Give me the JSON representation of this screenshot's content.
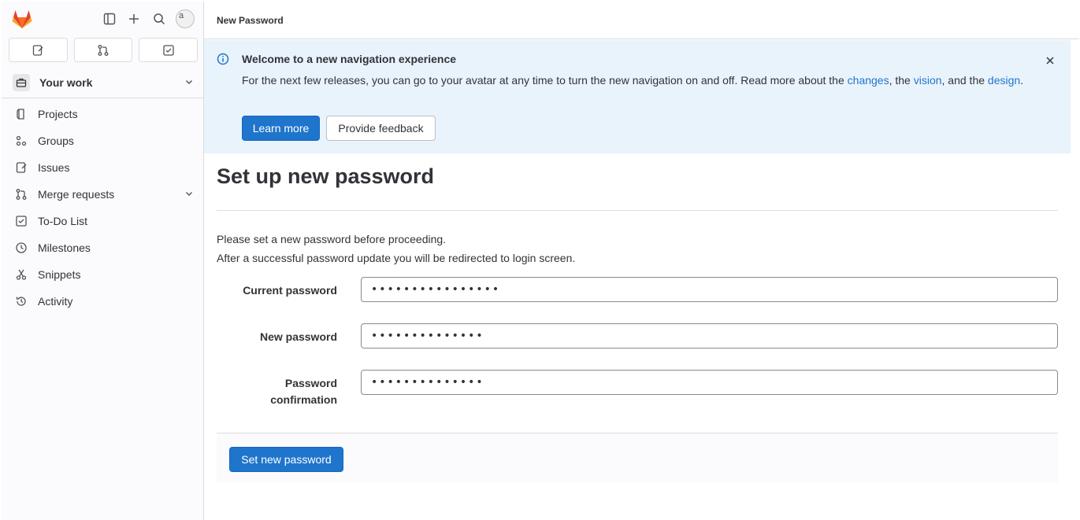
{
  "sidebar": {
    "avatar_alt": "a",
    "context_label": "Your work",
    "items": [
      {
        "label": "Projects"
      },
      {
        "label": "Groups"
      },
      {
        "label": "Issues"
      },
      {
        "label": "Merge requests"
      },
      {
        "label": "To-Do List"
      },
      {
        "label": "Milestones"
      },
      {
        "label": "Snippets"
      },
      {
        "label": "Activity"
      }
    ]
  },
  "topbar": {
    "title": "New Password"
  },
  "banner": {
    "title": "Welcome to a new navigation experience",
    "text_before": "For the next few releases, you can go to your avatar at any time to turn the new navigation on and off. Read more about the ",
    "link_changes": "changes",
    "text_mid1": ", the ",
    "link_vision": "vision",
    "text_mid2": ", and the ",
    "link_design": "design",
    "text_end": ".",
    "learn_more": "Learn more",
    "provide_feedback": "Provide feedback"
  },
  "page": {
    "title": "Set up new password",
    "intro_line1": "Please set a new password before proceeding.",
    "intro_line2": "After a successful password update you will be redirected to login screen."
  },
  "form": {
    "current_label": "Current password",
    "current_value": "••••••••••••••••",
    "new_label": "New password",
    "new_value": "••••••••••••••",
    "confirm_label_1": "Password",
    "confirm_label_2": "confirmation",
    "confirm_value": "••••••••••••••",
    "submit": "Set new password"
  },
  "colors": {
    "accent": "#1f75cb",
    "banner_bg": "#e9f3fc",
    "sidebar_bg": "#fbfafd",
    "logo": "#e24329"
  }
}
